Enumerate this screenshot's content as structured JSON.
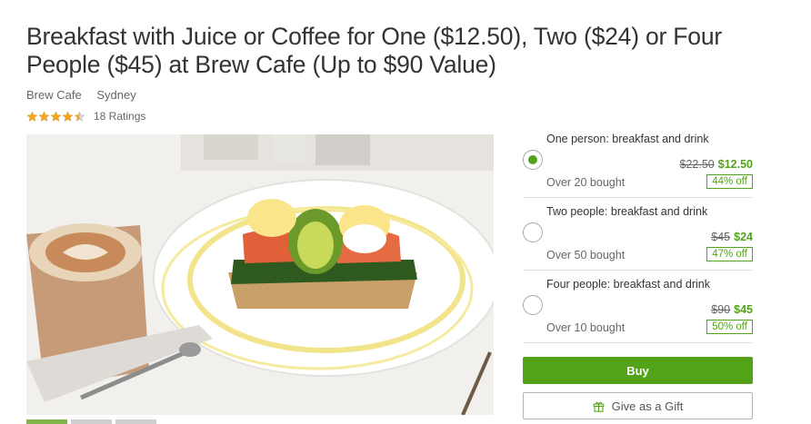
{
  "deal": {
    "title": "Breakfast with Juice or Coffee for One ($12.50), Two ($24) or Four People ($45) at Brew Cafe (Up to $90 Value)",
    "merchant": "Brew Cafe",
    "location": "Sydney",
    "ratings_text": "18 Ratings",
    "star_rating": 4.5
  },
  "options": [
    {
      "title": "One person: breakfast and drink",
      "old_price": "$22.50",
      "new_price": "$12.50",
      "bought": "Over 20 bought",
      "discount": "44% off",
      "selected": true
    },
    {
      "title": "Two people: breakfast and drink",
      "old_price": "$45",
      "new_price": "$24",
      "bought": "Over 50 bought",
      "discount": "47% off",
      "selected": false
    },
    {
      "title": "Four people: breakfast and drink",
      "old_price": "$90",
      "new_price": "$45",
      "bought": "Over 10 bought",
      "discount": "50% off",
      "selected": false
    }
  ],
  "actions": {
    "buy_label": "Buy",
    "gift_label": "Give as a Gift",
    "gift_icon": "gift-icon"
  },
  "colors": {
    "accent": "#53a318",
    "star": "#f6a623"
  }
}
